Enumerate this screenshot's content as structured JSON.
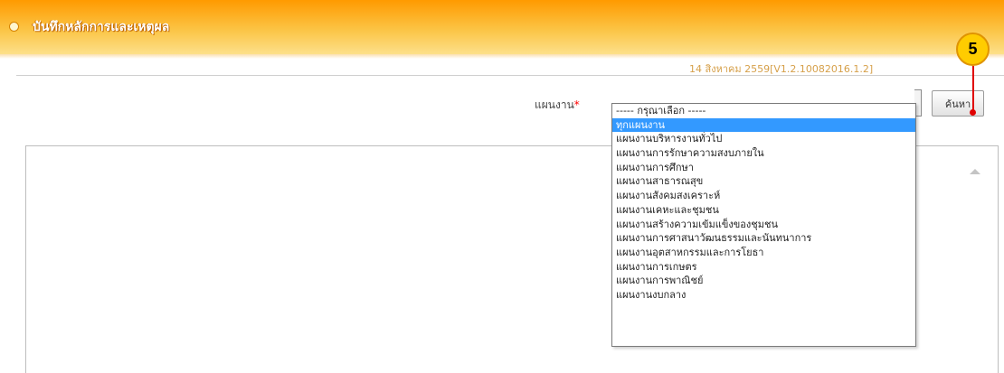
{
  "header": {
    "title": "บันทึกหลักการและเหตุผล",
    "date_version": "14 สิงหาคม 2559[V1.2.10082016.1.2]"
  },
  "form": {
    "field_label": "แผนงาน",
    "required_mark": "*"
  },
  "dropdown": {
    "options": [
      "----- กรุณาเลือก -----",
      "ทุกแผนงาน",
      "แผนงานบริหารงานทั่วไป",
      "แผนงานการรักษาความสงบภายใน",
      "แผนงานการศึกษา",
      "แผนงานสาธารณสุข",
      "แผนงานสังคมสงเคราะห์",
      "แผนงานเคหะและชุมชน",
      "แผนงานสร้างความเข้มแข็งของชุมชน",
      "แผนงานการศาสนาวัฒนธรรมและนันทนาการ",
      "แผนงานอุตสาหกรรมและการโยธา",
      "แผนงานการเกษตร",
      "แผนงานการพาณิชย์",
      "แผนงานงบกลาง"
    ],
    "selected_index": 1
  },
  "search_button": {
    "label": "ค้นหา"
  },
  "annotation": {
    "step_number": "5",
    "color": "#ffcc00",
    "pointer_color": "#e00000"
  },
  "colors": {
    "header_accent": "#ff9a00",
    "selection": "#3399ff"
  },
  "icons": {
    "scroll": "scroll-up-icon",
    "bullet": "bullet-icon"
  }
}
